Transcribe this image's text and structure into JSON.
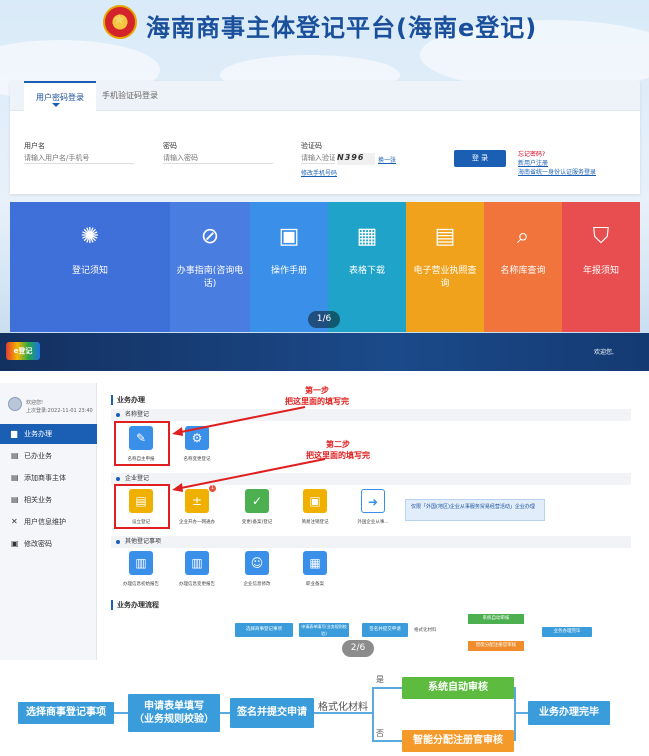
{
  "top": {
    "title": "海南商事主体登记平台(海南e登记)",
    "login": {
      "tabs": [
        "用户密码登录",
        "手机验证码登录"
      ],
      "username_label": "用户名",
      "username_placeholder": "请输入用户名/手机号",
      "password_label": "密码",
      "password_placeholder": "请输入密码",
      "captcha_label": "验证码",
      "captcha_placeholder": "请输入验证码",
      "captcha_text": "N396",
      "refresh_link": "换一张",
      "change_phone_link": "修改手机号码",
      "login_button": "登 录",
      "forgot_password": "忘记密码?",
      "register_link": "新用户注册",
      "ecert_link": "海南省统一身份认证服务登录"
    },
    "tiles": [
      {
        "label": "登记须知",
        "icon": "lightbulb-icon",
        "color": "#3f6fd8"
      },
      {
        "label": "办事指南(咨询电话)",
        "icon": "compass-icon",
        "color": "#4a7de0"
      },
      {
        "label": "操作手册",
        "icon": "manual-icon",
        "color": "#3a8fe8"
      },
      {
        "label": "表格下载",
        "icon": "table-icon",
        "color": "#1fa3c9"
      },
      {
        "label": "电子营业执照查询",
        "icon": "license-icon",
        "color": "#f0a21c"
      },
      {
        "label": "名称库查询",
        "icon": "name-search-icon",
        "color": "#f0743c"
      },
      {
        "label": "年报须知",
        "icon": "annual-report-icon",
        "color": "#e84d4f"
      }
    ],
    "pager": "1/6"
  },
  "mid": {
    "header_welcome": "欢迎您,",
    "sidebar": {
      "welcome": "欢迎您!",
      "last_login": "上次登录:2022-11-01 23:40",
      "items": [
        {
          "label": "业务办理",
          "icon": "briefcase-icon"
        },
        {
          "label": "已办业务",
          "icon": "done-icon"
        },
        {
          "label": "添加商事主体",
          "icon": "add-icon"
        },
        {
          "label": "相关业务",
          "icon": "related-icon"
        },
        {
          "label": "用户信息维护",
          "icon": "tools-icon"
        },
        {
          "label": "修改密码",
          "icon": "lock-icon"
        }
      ]
    },
    "panel_title": "业务办理",
    "sections": [
      "名称登记",
      "企业登记",
      "其他登记事项"
    ],
    "name_items": [
      "名称自主申报",
      "名称变更登记"
    ],
    "company_items": [
      "设立登记",
      "企业开办一网通办",
      "变更(备案)登记",
      "简易注销登记",
      "外国企业从事..."
    ],
    "other_items": [
      "办理信息初始报告",
      "办理信息变更报告",
      "企业信息修改",
      "职业备案"
    ],
    "tooltip": "仅限「外国(地区)企业从事服务贸易经营活动」企业办理",
    "annotation1": "第一步\n把这里面的填写完",
    "annotation2": "第二步\n把这里面的填写完",
    "badge": "1",
    "flow_title": "业务办理流程",
    "flow": {
      "step1": "选择商事登记事项",
      "step2": "申请表单填写(业务规则校验)",
      "step3": "签名并提交申请",
      "step4": "格式化材料",
      "auto": "系统自动审核",
      "manual": "智能分配注册官审核",
      "done": "业务办理完毕"
    },
    "pager": "2/6"
  },
  "bottom_flow": {
    "step1": "选择商事登记事项",
    "step2_line1": "申请表单填写",
    "step2_line2": "（业务规则校验）",
    "step3": "签名并提交申请",
    "step4": "格式化材料",
    "yes": "是",
    "no": "否",
    "auto": "系统自动审核",
    "manual": "智能分配注册官审核",
    "done": "业务办理完毕"
  }
}
